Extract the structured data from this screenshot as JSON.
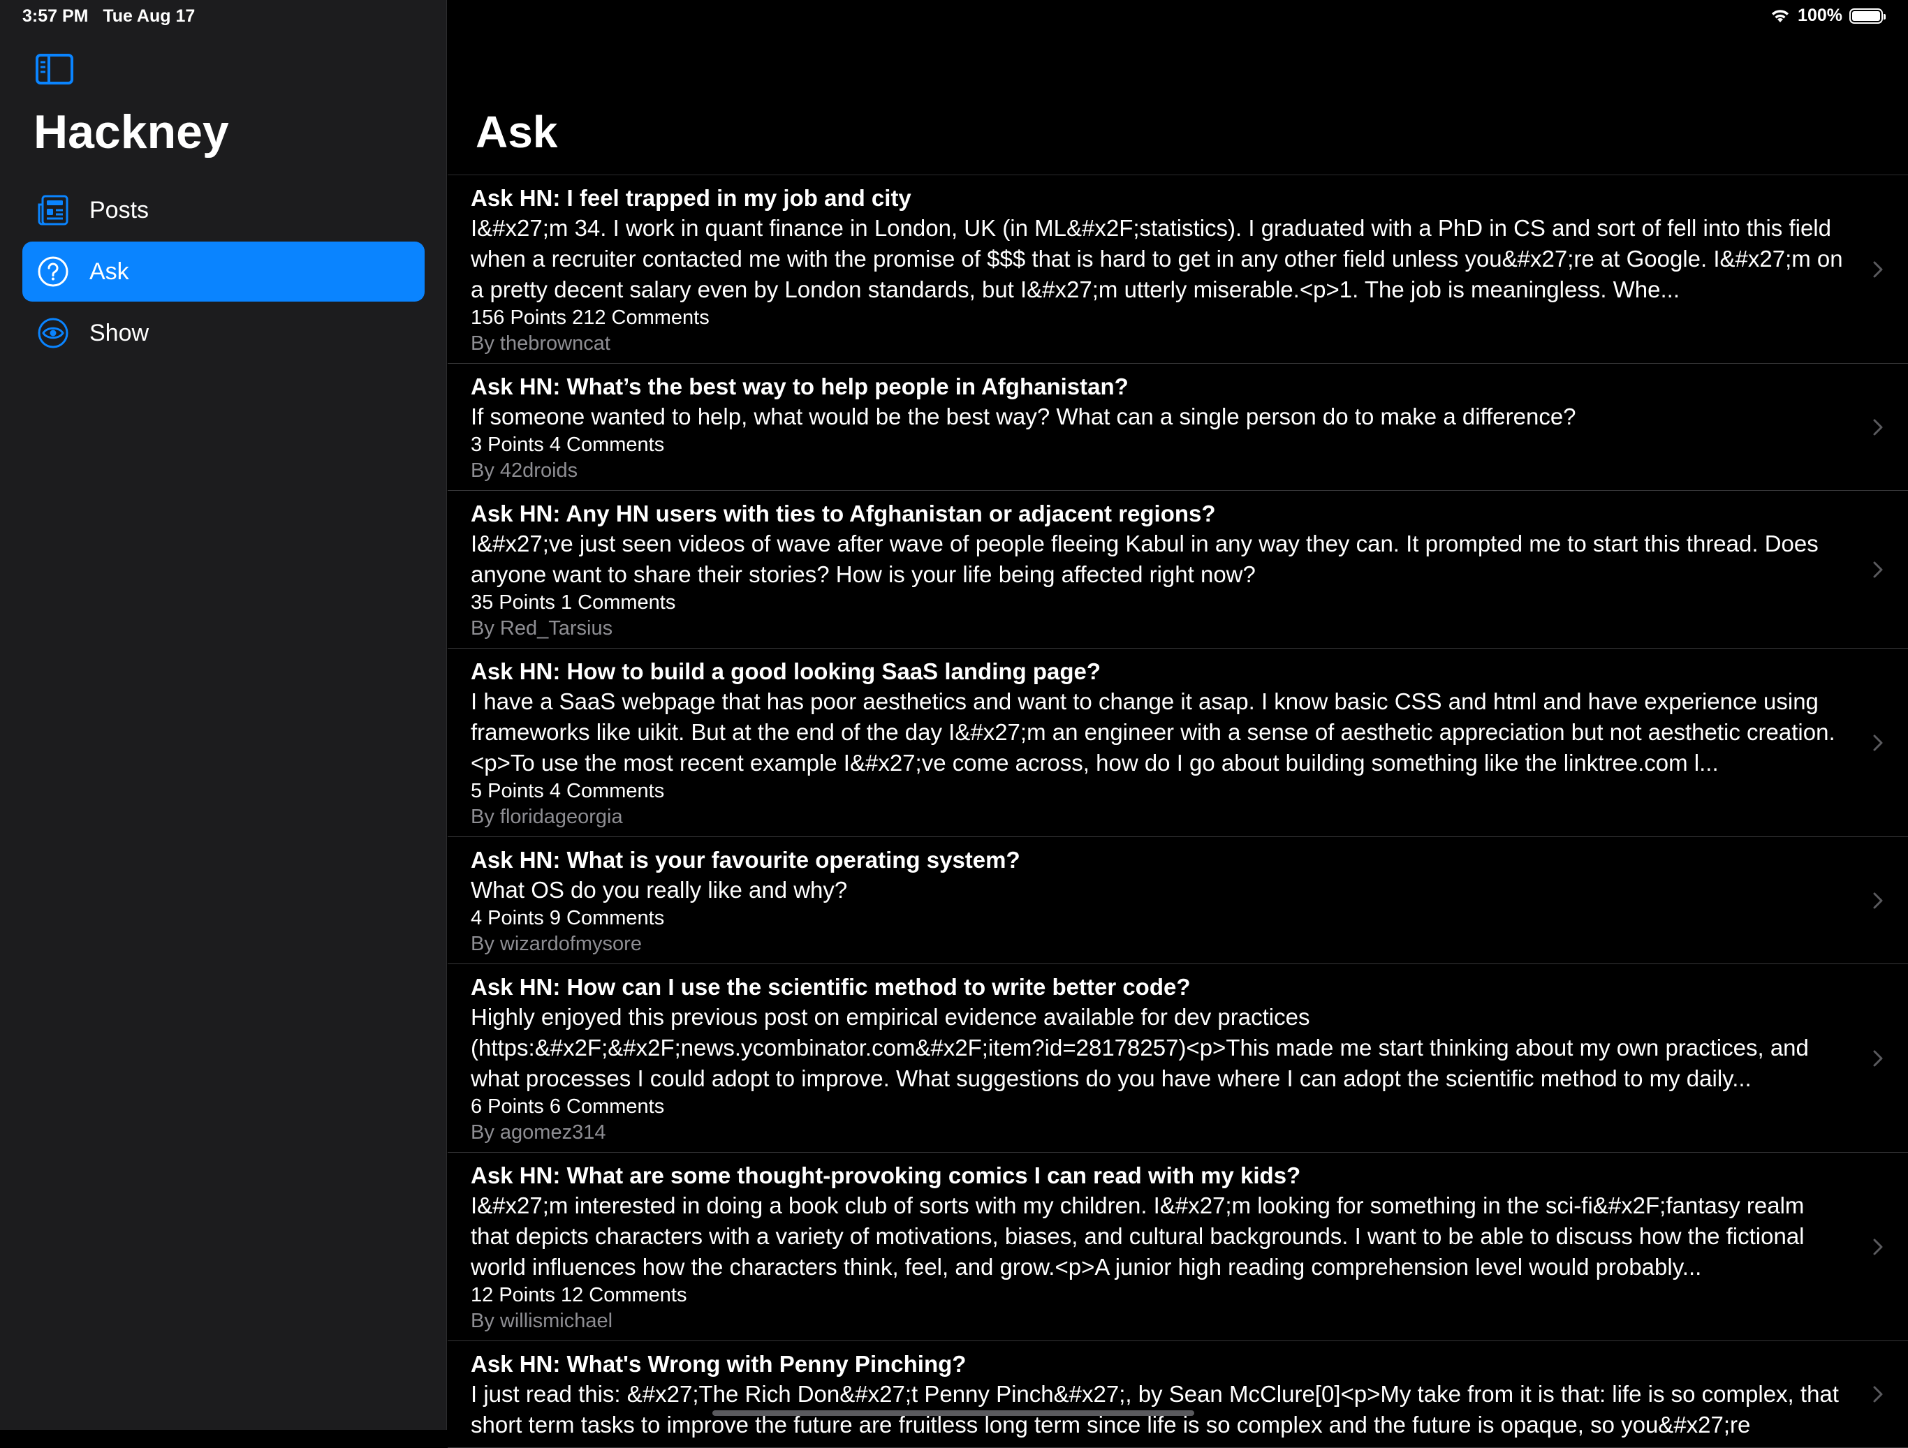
{
  "status": {
    "time": "3:57 PM",
    "date": "Tue Aug 17",
    "battery": "100%",
    "battery_level": 1.0
  },
  "sidebar": {
    "app_title": "Hackney",
    "items": [
      {
        "label": "Posts",
        "icon": "newspaper-icon",
        "active": false
      },
      {
        "label": "Ask",
        "icon": "question-circle-icon",
        "active": true
      },
      {
        "label": "Show",
        "icon": "eye-icon",
        "active": false
      }
    ]
  },
  "main": {
    "title": "Ask",
    "posts": [
      {
        "title": "Ask HN: I feel trapped in my job and city",
        "body": "I&#x27;m 34. I work in quant finance in London, UK (in ML&#x2F;statistics). I graduated with a PhD in CS and sort of fell into this field when a recruiter contacted me with the promise of $$$ that is hard to get in any other field unless you&#x27;re at Google. I&#x27;m on a pretty decent salary even by London standards, but I&#x27;m utterly miserable.<p>1. The job is meaningless. Whe...",
        "stats": "156 Points  212 Comments",
        "author": "By thebrowncat"
      },
      {
        "title": "Ask HN: What’s the best way to help people in Afghanistan?",
        "body": "If someone wanted to help, what would be the best way? What can a single person do to make a difference?",
        "stats": "3 Points  4 Comments",
        "author": "By 42droids"
      },
      {
        "title": "Ask HN: Any HN users with ties to Afghanistan or adjacent regions?",
        "body": "I&#x27;ve just seen videos of wave after wave of people fleeing Kabul in any way they can. It prompted me to start this thread. Does anyone want to share their stories? How is your life being affected right now?",
        "stats": "35 Points  1 Comments",
        "author": "By Red_Tarsius"
      },
      {
        "title": "Ask HN: How to build a good looking SaaS landing page?",
        "body": "I have a SaaS webpage that has poor aesthetics and want to change it asap. I know basic CSS and html and have experience using frameworks like uikit. But at the end of the day I&#x27;m an engineer with a sense of aesthetic appreciation but not aesthetic creation.<p>To use the most recent example I&#x27;ve come across, how do I go about building something like the linktree.com l...",
        "stats": "5 Points  4 Comments",
        "author": "By floridageorgia"
      },
      {
        "title": "Ask HN: What is your favourite operating system?",
        "body": "What OS do you really like and why?",
        "stats": "4 Points  9 Comments",
        "author": "By wizardofmysore"
      },
      {
        "title": "Ask HN: How can I use the scientific method to write better code?",
        "body": "Highly enjoyed this previous post on empirical evidence available for dev practices (https:&#x2F;&#x2F;news.ycombinator.com&#x2F;item?id=28178257)<p>This made me start thinking about my own practices, and what processes I could adopt to improve. What suggestions do you have where I can adopt the scientific method to my daily...",
        "stats": "6 Points  6 Comments",
        "author": "By agomez314"
      },
      {
        "title": "Ask HN: What are some thought-provoking comics I can read with my kids?",
        "body": "I&#x27;m interested in doing a book club of sorts with my children. I&#x27;m looking for something in the sci-fi&#x2F;fantasy realm that depicts characters with a variety of motivations, biases, and cultural backgrounds. I want to be able to discuss how the fictional world influences how the characters think, feel, and grow.<p>A junior high reading comprehension level would probably...",
        "stats": "12 Points  12 Comments",
        "author": "By willismichael"
      },
      {
        "title": "Ask HN: What's Wrong with Penny Pinching?",
        "body": "I just read this: &#x27;The Rich Don&#x27;t Penny Pinch&#x27;, by Sean McClure[0]<p>My take from it is that: life is so complex, that short term tasks to improve the future are fruitless long term since life is so complex and the future is opaque, so you&#x27;re",
        "stats": "",
        "author": ""
      }
    ]
  }
}
